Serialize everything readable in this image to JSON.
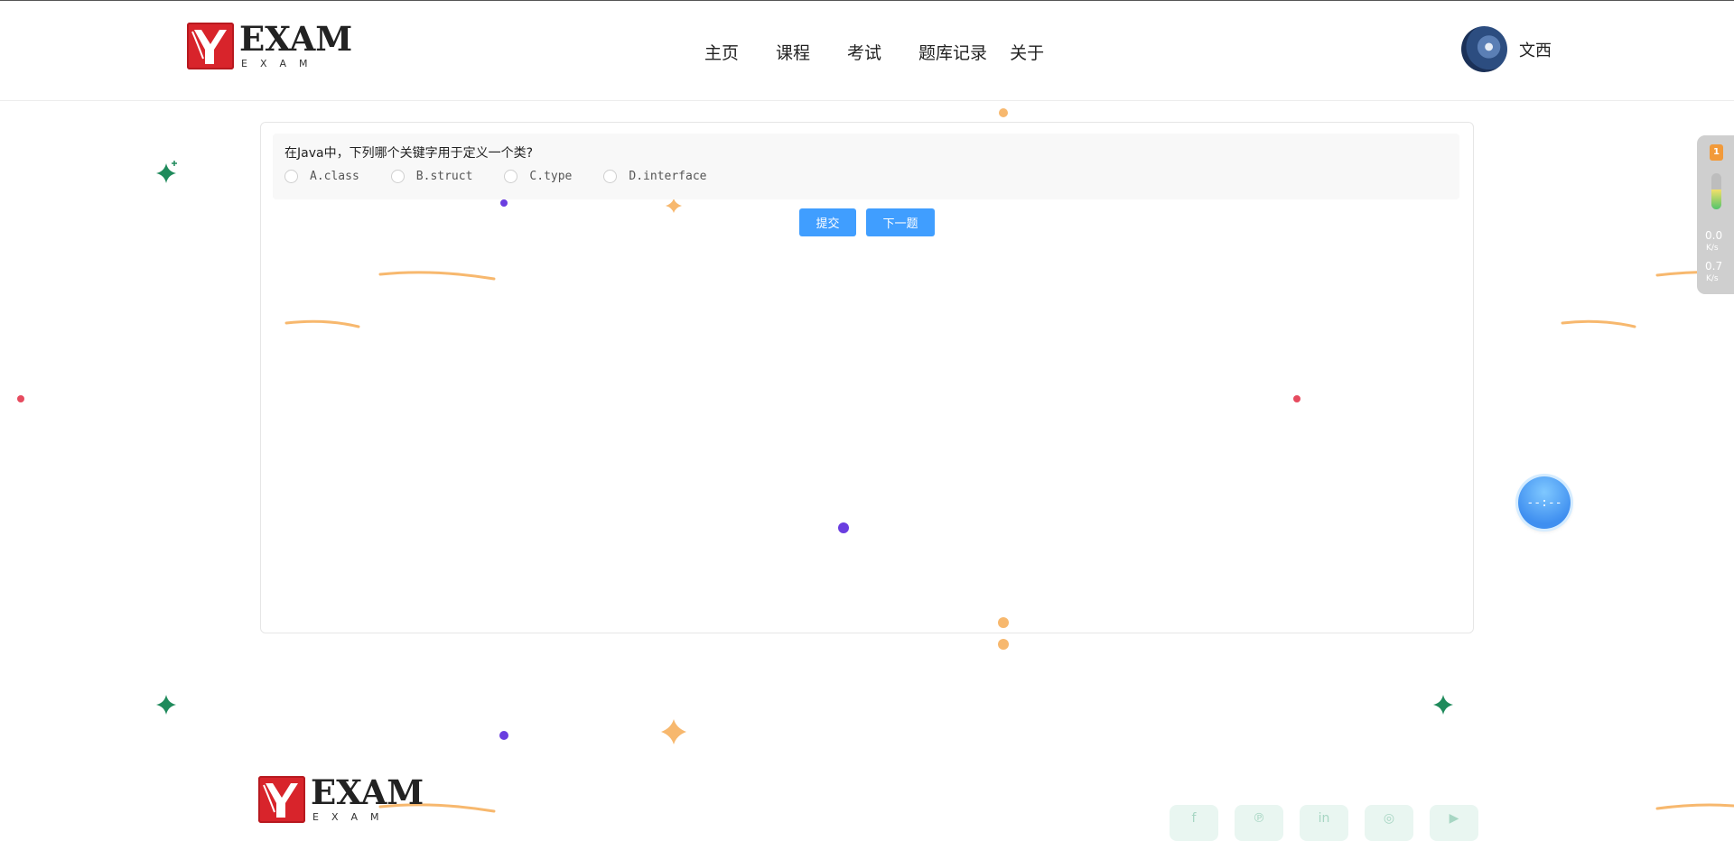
{
  "header": {
    "logo_title": "EXAM",
    "logo_sub": "EXAM",
    "nav": [
      {
        "label": "主页"
      },
      {
        "label": "课程"
      },
      {
        "label": "考试"
      },
      {
        "label": "题库记录"
      },
      {
        "label": "关于"
      }
    ],
    "user_name": "文西"
  },
  "question": {
    "text": "在Java中，下列哪个关键字用于定义一个类?",
    "options": [
      {
        "label": "A.class"
      },
      {
        "label": "B.struct"
      },
      {
        "label": "C.type"
      },
      {
        "label": "D.interface"
      }
    ]
  },
  "buttons": {
    "submit": "提交",
    "next": "下一题"
  },
  "side_widget": {
    "badge": "1",
    "upload_value": "0.0",
    "upload_unit": "K/s",
    "download_value": "0.7",
    "download_unit": "K/s"
  },
  "timer": {
    "text": "--:--"
  },
  "footer": {
    "logo_title": "EXAM",
    "logo_sub": "EXAM",
    "social": [
      "facebook-icon",
      "pinterest-icon",
      "linkedin-icon",
      "instagram-icon",
      "youtube-icon"
    ]
  },
  "colors": {
    "primary": "#409eff",
    "logo_red": "#d8242b",
    "deco_orange": "#f7b86e",
    "deco_green": "#1f8a5b",
    "deco_purple": "#6a3ee0",
    "deco_red": "#e64b5f"
  }
}
